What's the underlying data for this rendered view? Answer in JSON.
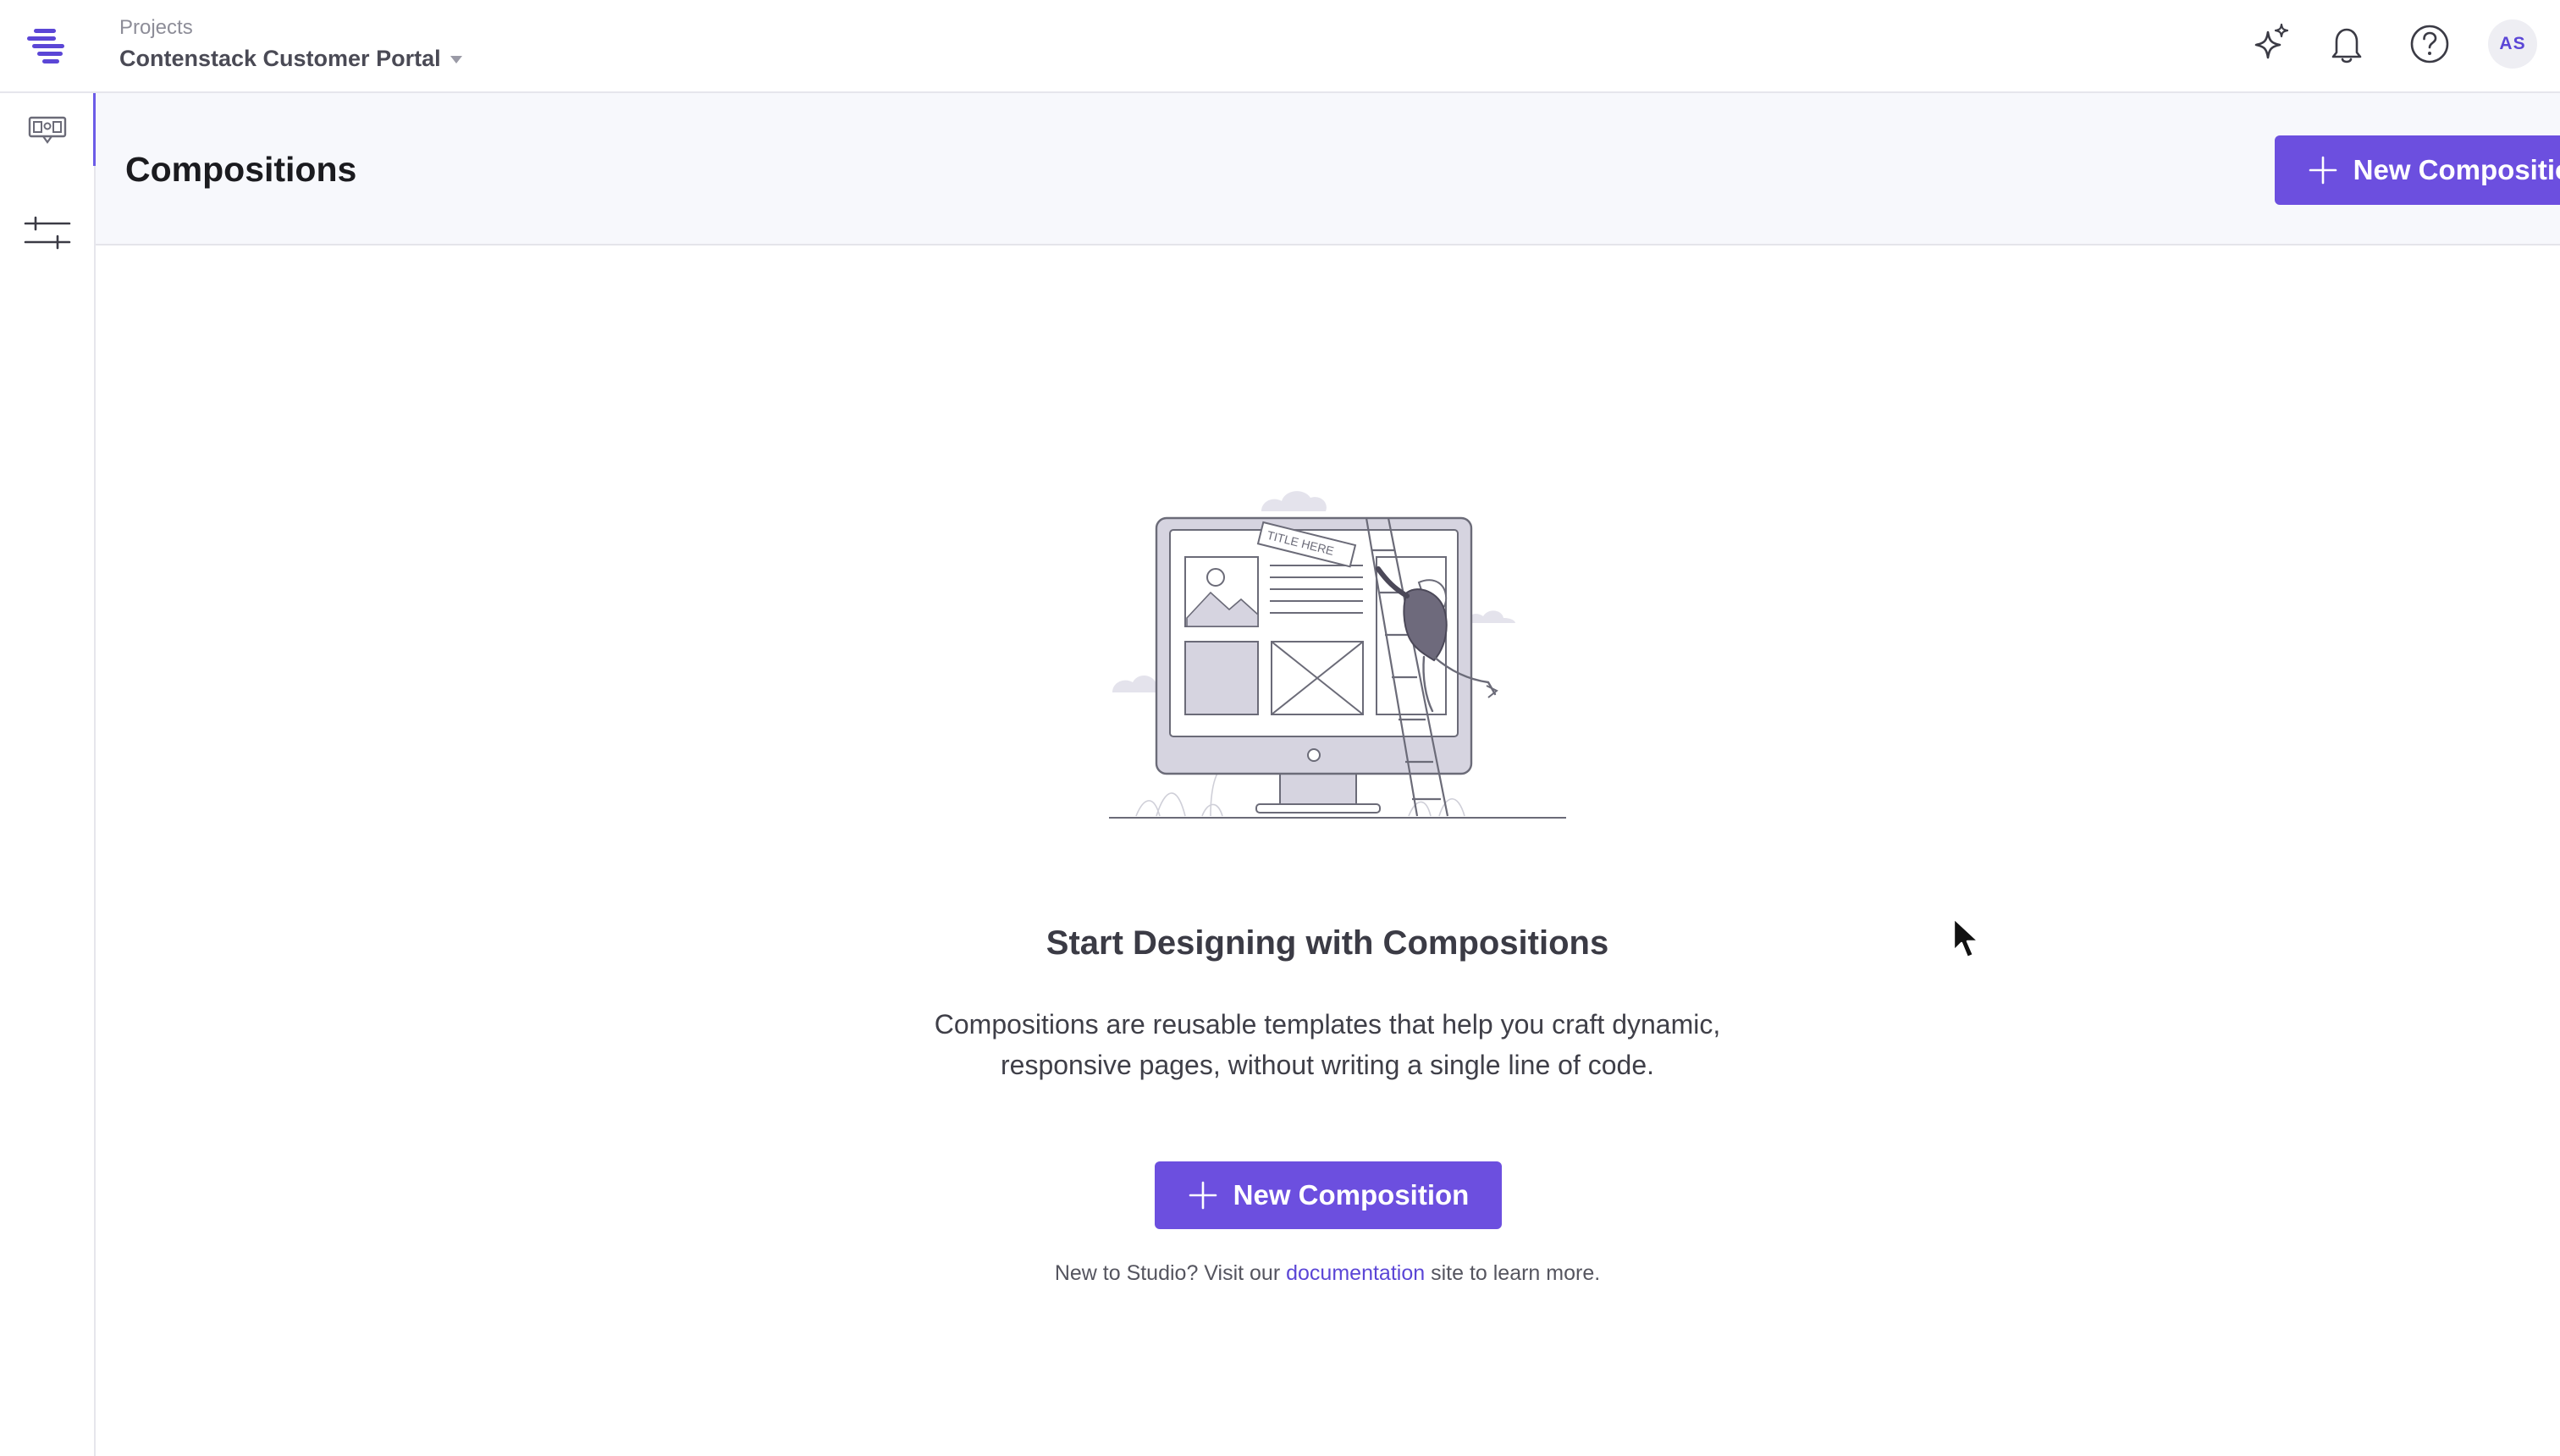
{
  "topbar": {
    "project_label": "Projects",
    "project_name": "Contenstack Customer Portal",
    "icons": [
      "logo-icon",
      "sparkle-icon",
      "bell-icon",
      "help-icon"
    ],
    "avatar_initials": "AS"
  },
  "sidebar": {
    "items": [
      {
        "icon": "compositions-icon",
        "active": true
      },
      {
        "icon": "settings-sliders-icon",
        "active": false
      }
    ]
  },
  "header": {
    "title": "Compositions",
    "new_button_label": "New Composition"
  },
  "empty_state": {
    "illustration_sign": "TITLE HERE",
    "title": "Start Designing with Compositions",
    "description": "Compositions are reusable templates that help you craft dynamic, responsive pages, without writing a single line of code.",
    "button_label": "New Composition",
    "footnote_prefix": "New to Studio? Visit our",
    "footnote_link": "documentation",
    "footnote_suffix": "site to learn more."
  },
  "colors": {
    "accent": "#6c4fdf",
    "header_bg": "#f7f8fc",
    "border": "#e6e6ec",
    "link": "#5b46d6"
  }
}
